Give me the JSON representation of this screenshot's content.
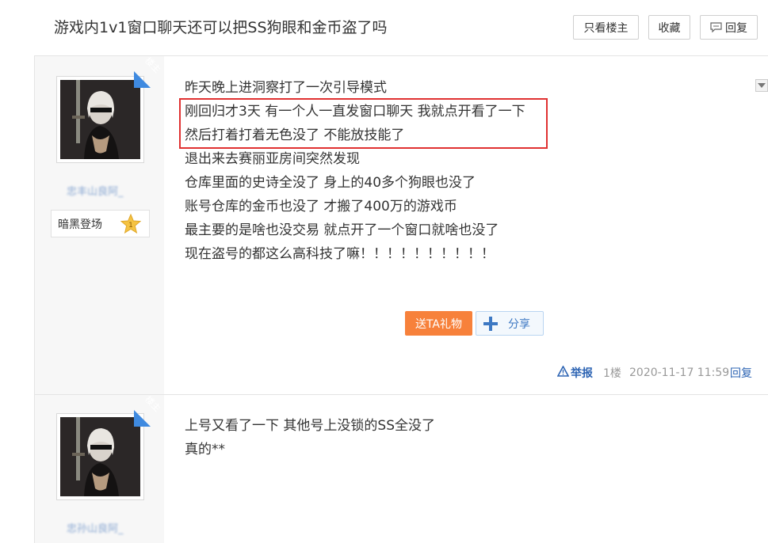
{
  "header": {
    "title": "游戏内1v1窗口聊天还可以把SS狗眼和金币盗了吗",
    "only_op_label": "只看楼主",
    "favorite_label": "收藏",
    "reply_label": "回复"
  },
  "posts": [
    {
      "op_badge": "楼主",
      "username": "忠丰山良阿_",
      "level_name": "暗黑登场",
      "level_number": "1",
      "lines": [
        "昨天晚上进洞察打了一次引导模式",
        "刚回归才3天 有一个人一直发窗口聊天 我就点开看了一下",
        "然后打着打着无色没了 不能放技能了",
        "退出来去赛丽亚房间突然发现",
        "仓库里面的史诗全没了 身上的40多个狗眼也没了",
        "账号仓库的金币也没了 才搬了400万的游戏币",
        "最主要的是啥也没交易 就点开了一个窗口就啥也没了",
        "现在盗号的都这么高科技了嘛！！！！！！！！！！"
      ],
      "gift_label": "送TA礼物",
      "share_label": "分享",
      "report_label": "举报",
      "floor": "1楼",
      "time": "2020-11-17 11:59",
      "reply_label": "回复"
    },
    {
      "op_badge": "楼主",
      "username": "忠孙山良阿_",
      "lines": [
        "上号又看了一下 其他号上没锁的SS全没了",
        "真的**"
      ]
    }
  ],
  "colors": {
    "highlight": "#e03131",
    "link": "#2d64b3",
    "gift": "#f7813b",
    "op_ribbon": "#3f8ae0"
  }
}
